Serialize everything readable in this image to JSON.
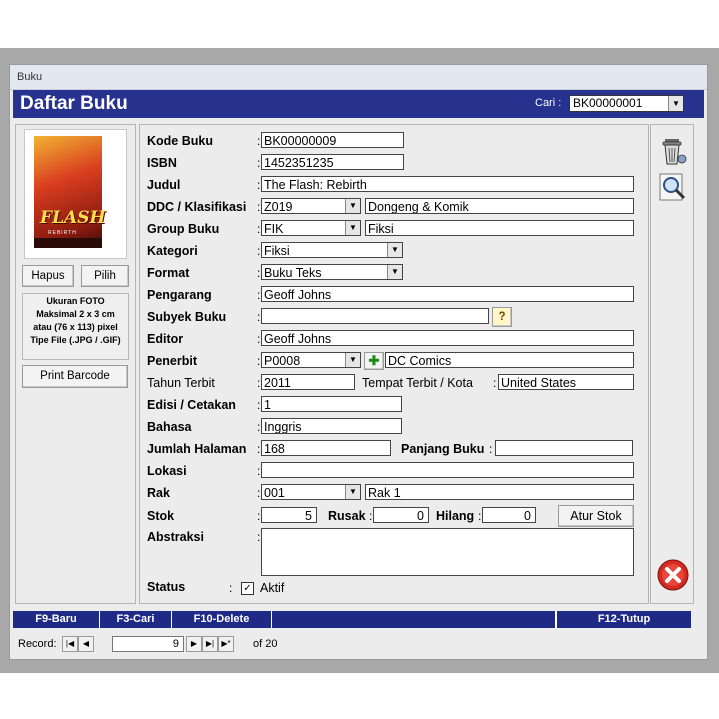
{
  "window": {
    "title": "Buku"
  },
  "header": {
    "title": "Daftar Buku",
    "search_label": "Cari :",
    "search_value": "BK00000001"
  },
  "left_panel": {
    "cover_title": "FLASH",
    "cover_subtitle": "REBIRTH",
    "hapus_label": "Hapus",
    "pilih_label": "Pilih",
    "photo_info": [
      "Ukuran FOTO",
      "Maksimal 2 x 3 cm",
      "atau (76 x 113) pixel",
      "Tipe File (.JPG / .GIF)"
    ],
    "print_barcode_label": "Print Barcode"
  },
  "form": {
    "kode_buku": {
      "label": "Kode Buku",
      "value": "BK00000009"
    },
    "isbn": {
      "label": "ISBN",
      "value": "1452351235"
    },
    "judul": {
      "label": "Judul",
      "value": "The Flash: Rebirth"
    },
    "ddc": {
      "label": "DDC / Klasifikasi",
      "value": "Z019",
      "desc": "Dongeng & Komik"
    },
    "group": {
      "label": "Group Buku",
      "value": "FIK",
      "desc": "Fiksi"
    },
    "kategori": {
      "label": "Kategori",
      "value": "Fiksi"
    },
    "format": {
      "label": "Format",
      "value": "Buku Teks"
    },
    "pengarang": {
      "label": "Pengarang",
      "value": "Geoff Johns"
    },
    "subyek": {
      "label": "Subyek Buku",
      "value": ""
    },
    "editor": {
      "label": "Editor",
      "value": "Geoff Johns"
    },
    "penerbit": {
      "label": "Penerbit",
      "value": "P0008",
      "desc": "DC Comics"
    },
    "tahun": {
      "label": "Tahun Terbit",
      "value": "2011"
    },
    "tempat": {
      "label": "Tempat Terbit / Kota",
      "value": "United States"
    },
    "edisi": {
      "label": "Edisi / Cetakan",
      "value": "1"
    },
    "bahasa": {
      "label": "Bahasa",
      "value": "Inggris"
    },
    "halaman": {
      "label": "Jumlah Halaman",
      "value": "168"
    },
    "panjang": {
      "label": "Panjang Buku",
      "value": ""
    },
    "lokasi": {
      "label": "Lokasi",
      "value": ""
    },
    "rak": {
      "label": "Rak",
      "value": "001",
      "desc": "Rak 1"
    },
    "stok": {
      "label": "Stok",
      "value": "5"
    },
    "rusak": {
      "label": "Rusak",
      "value": "0"
    },
    "hilang": {
      "label": "Hilang",
      "value": "0"
    },
    "atur_stok_label": "Atur Stok",
    "abstraksi": {
      "label": "Abstraksi",
      "value": ""
    },
    "status": {
      "label": "Status",
      "checkbox_label": "Aktif",
      "checked": true
    }
  },
  "function_keys": [
    "F9-Baru",
    "F3-Cari",
    "F10-Delete",
    "F12-Tutup"
  ],
  "record_nav": {
    "label": "Record:",
    "current": "9",
    "of_text": "of 20"
  },
  "colors": {
    "header_bg": "#27318e",
    "statusbar_bg": "#1f2a86",
    "close_red": "#d42a20"
  }
}
